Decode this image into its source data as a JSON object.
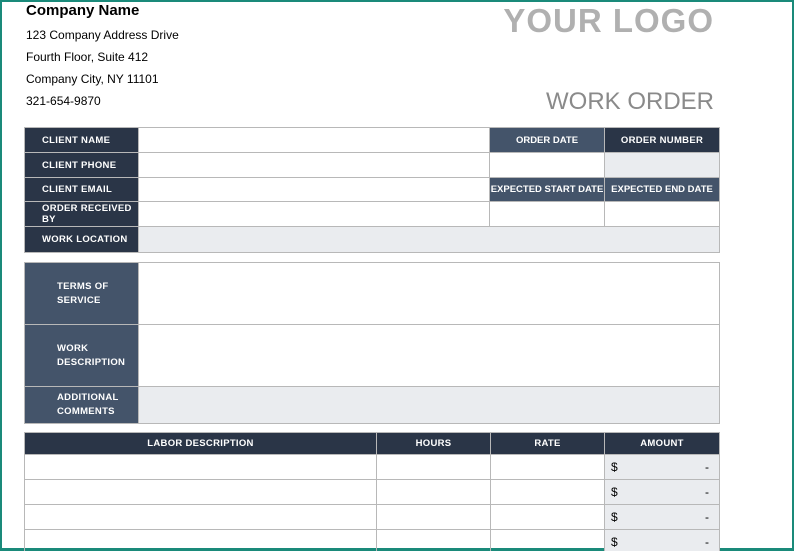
{
  "company": {
    "name": "Company Name",
    "address_line1": "123 Company Address Drive",
    "address_line2": "Fourth Floor, Suite 412",
    "address_line3": "Company City, NY  11101",
    "phone": "321-654-9870"
  },
  "logo_text": "YOUR LOGO",
  "title": "WORK ORDER",
  "client_section": {
    "client_name": "CLIENT NAME",
    "client_phone": "CLIENT PHONE",
    "client_email": "CLIENT EMAIL",
    "order_received_by": "ORDER RECEIVED BY",
    "work_location": "WORK LOCATION",
    "order_date": "ORDER DATE",
    "order_number": "ORDER NUMBER",
    "expected_start_date": "EXPECTED START DATE",
    "expected_end_date": "EXPECTED END DATE"
  },
  "details_section": {
    "terms_of_service": "TERMS OF SERVICE",
    "work_description": "WORK DESCRIPTION",
    "additional_comments": "ADDITIONAL COMMENTS"
  },
  "labor_table": {
    "headers": {
      "description": "LABOR DESCRIPTION",
      "hours": "HOURS",
      "rate": "RATE",
      "amount": "AMOUNT"
    },
    "rows": [
      {
        "currency": "$",
        "amount": "-"
      },
      {
        "currency": "$",
        "amount": "-"
      },
      {
        "currency": "$",
        "amount": "-"
      },
      {
        "currency": "$",
        "amount": "-"
      }
    ]
  },
  "colors": {
    "dark_header": "#2a3547",
    "mid_header": "#44546a",
    "light_fill": "#eaecef",
    "frame": "#1a8a7a"
  }
}
